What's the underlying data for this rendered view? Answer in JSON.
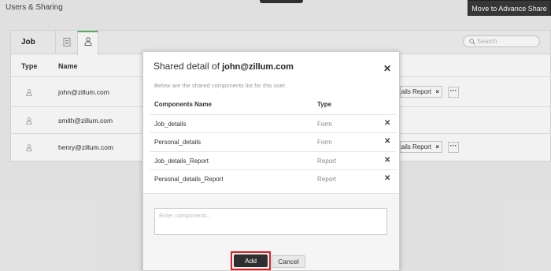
{
  "header": {
    "title": "Users & Sharing",
    "advance_share_label": "Move to Advance Share"
  },
  "tabs": {
    "job_label": "Job",
    "form_tab_icon": "form-icon",
    "user_tab_icon": "user-icon"
  },
  "search": {
    "placeholder": "Search"
  },
  "table": {
    "columns": [
      "Type",
      "Name"
    ],
    "rows": [
      {
        "type_icon": "user-icon",
        "name": "john@zillum.com",
        "chip": "Job_details Report",
        "has_more": true
      },
      {
        "type_icon": "user-icon",
        "name": "smith@zillum.com",
        "chip": "",
        "has_more": false
      },
      {
        "type_icon": "user-icon",
        "name": "henry@zillum.com",
        "chip": "Job_details Report",
        "has_more": true
      }
    ]
  },
  "modal": {
    "title_prefix": "Shared detail of",
    "title_email": "john@zillum.com",
    "close_icon": "close-icon",
    "subtitle": "Below are the shared components list for this user.",
    "columns": [
      "Components Name",
      "Type"
    ],
    "components": [
      {
        "name": "Job_details",
        "type": "Form"
      },
      {
        "name": "Personal_details",
        "type": "Form"
      },
      {
        "name": "Job_details_Report",
        "type": "Report"
      },
      {
        "name": "Personal_details_Report",
        "type": "Report"
      }
    ],
    "input_placeholder": "Enter components...",
    "add_label": "Add",
    "cancel_label": "Cancel"
  },
  "colors": {
    "accent_green": "#5cb85c",
    "focus_red": "#e01b22",
    "dark_button": "#2f2f2f"
  }
}
